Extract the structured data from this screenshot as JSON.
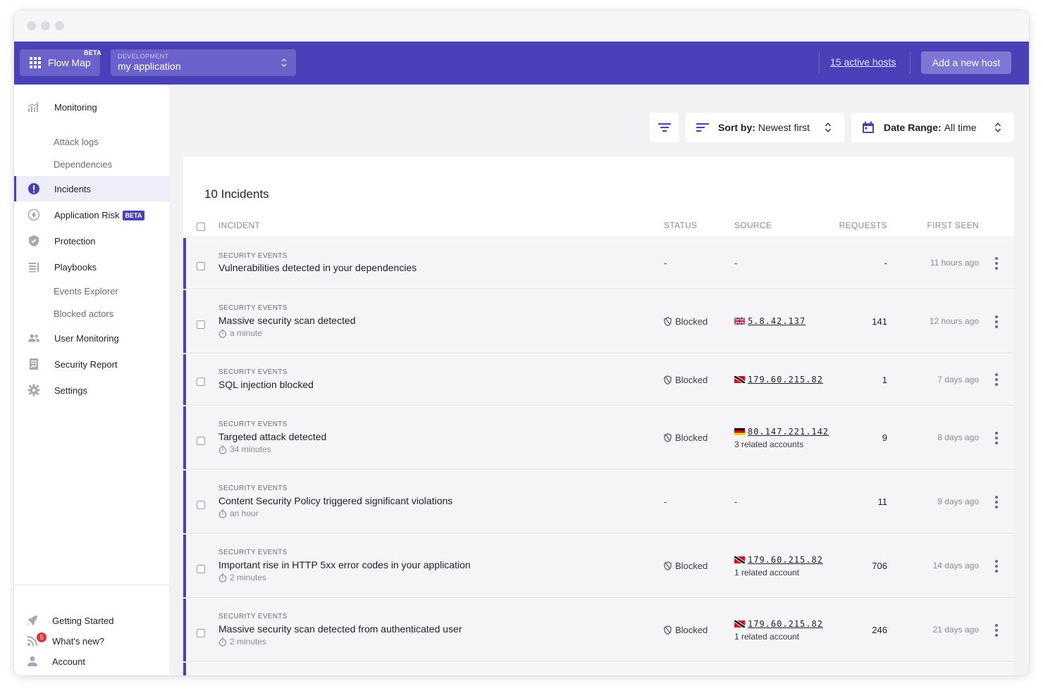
{
  "topbar": {
    "flow_map_label": "Flow Map",
    "flow_map_badge": "BETA",
    "app_env": "DEVELOPMENT",
    "app_name": "my application",
    "active_hosts": "15 active hosts",
    "add_host": "Add a new host"
  },
  "sidebar": {
    "monitoring": "Monitoring",
    "attack_logs": "Attack logs",
    "dependencies": "Dependencies",
    "incidents": "Incidents",
    "application_risk": "Application Risk",
    "application_risk_badge": "BETA",
    "protection": "Protection",
    "playbooks": "Playbooks",
    "events_explorer": "Events Explorer",
    "blocked_actors": "Blocked actors",
    "user_monitoring": "User Monitoring",
    "security_report": "Security Report",
    "settings": "Settings",
    "getting_started": "Getting Started",
    "whats_new": "What's new?",
    "whats_new_count": "5",
    "account": "Account"
  },
  "toolbar": {
    "sort_label": "Sort by:",
    "sort_value": "Newest first",
    "date_label": "Date Range:",
    "date_value": "All time"
  },
  "incidents": {
    "title": "10 Incidents",
    "columns": {
      "incident": "INCIDENT",
      "status": "STATUS",
      "source": "SOURCE",
      "requests": "REQUESTS",
      "first_seen": "FIRST SEEN"
    },
    "rows": [
      {
        "category": "SECURITY EVENTS",
        "title": "Vulnerabilities detected in your dependencies",
        "duration": "",
        "status": "-",
        "source_ip": "-",
        "related": "",
        "requests": "-",
        "first_seen": "11 hours ago"
      },
      {
        "category": "SECURITY EVENTS",
        "title": "Massive security scan detected",
        "duration": "a minute",
        "status": "Blocked",
        "source_ip": "5.8.42.137",
        "related": "",
        "requests": "141",
        "first_seen": "12 hours ago",
        "flag": "gb"
      },
      {
        "category": "SECURITY EVENTS",
        "title": "SQL injection blocked",
        "duration": "",
        "status": "Blocked",
        "source_ip": "179.60.215.82",
        "related": "",
        "requests": "1",
        "first_seen": "7 days ago",
        "flag": "tt"
      },
      {
        "category": "SECURITY EVENTS",
        "title": "Targeted attack detected",
        "duration": "34 minutes",
        "status": "Blocked",
        "source_ip": "80.147.221.142",
        "related": "3 related accounts",
        "requests": "9",
        "first_seen": "8 days ago",
        "flag": "de"
      },
      {
        "category": "SECURITY EVENTS",
        "title": "Content Security Policy triggered significant violations",
        "duration": "an hour",
        "status": "-",
        "source_ip": "-",
        "related": "",
        "requests": "11",
        "first_seen": "9 days ago"
      },
      {
        "category": "SECURITY EVENTS",
        "title": "Important rise in HTTP 5xx error codes in your application",
        "duration": "2 minutes",
        "status": "Blocked",
        "source_ip": "179.60.215.82",
        "related": "1 related account",
        "requests": "706",
        "first_seen": "14 days ago",
        "flag": "tt"
      },
      {
        "category": "SECURITY EVENTS",
        "title": "Massive security scan detected from authenticated user",
        "duration": "2 minutes",
        "status": "Blocked",
        "source_ip": "179.60.215.82",
        "related": "1 related account",
        "requests": "246",
        "first_seen": "21 days ago",
        "flag": "tt"
      }
    ]
  }
}
